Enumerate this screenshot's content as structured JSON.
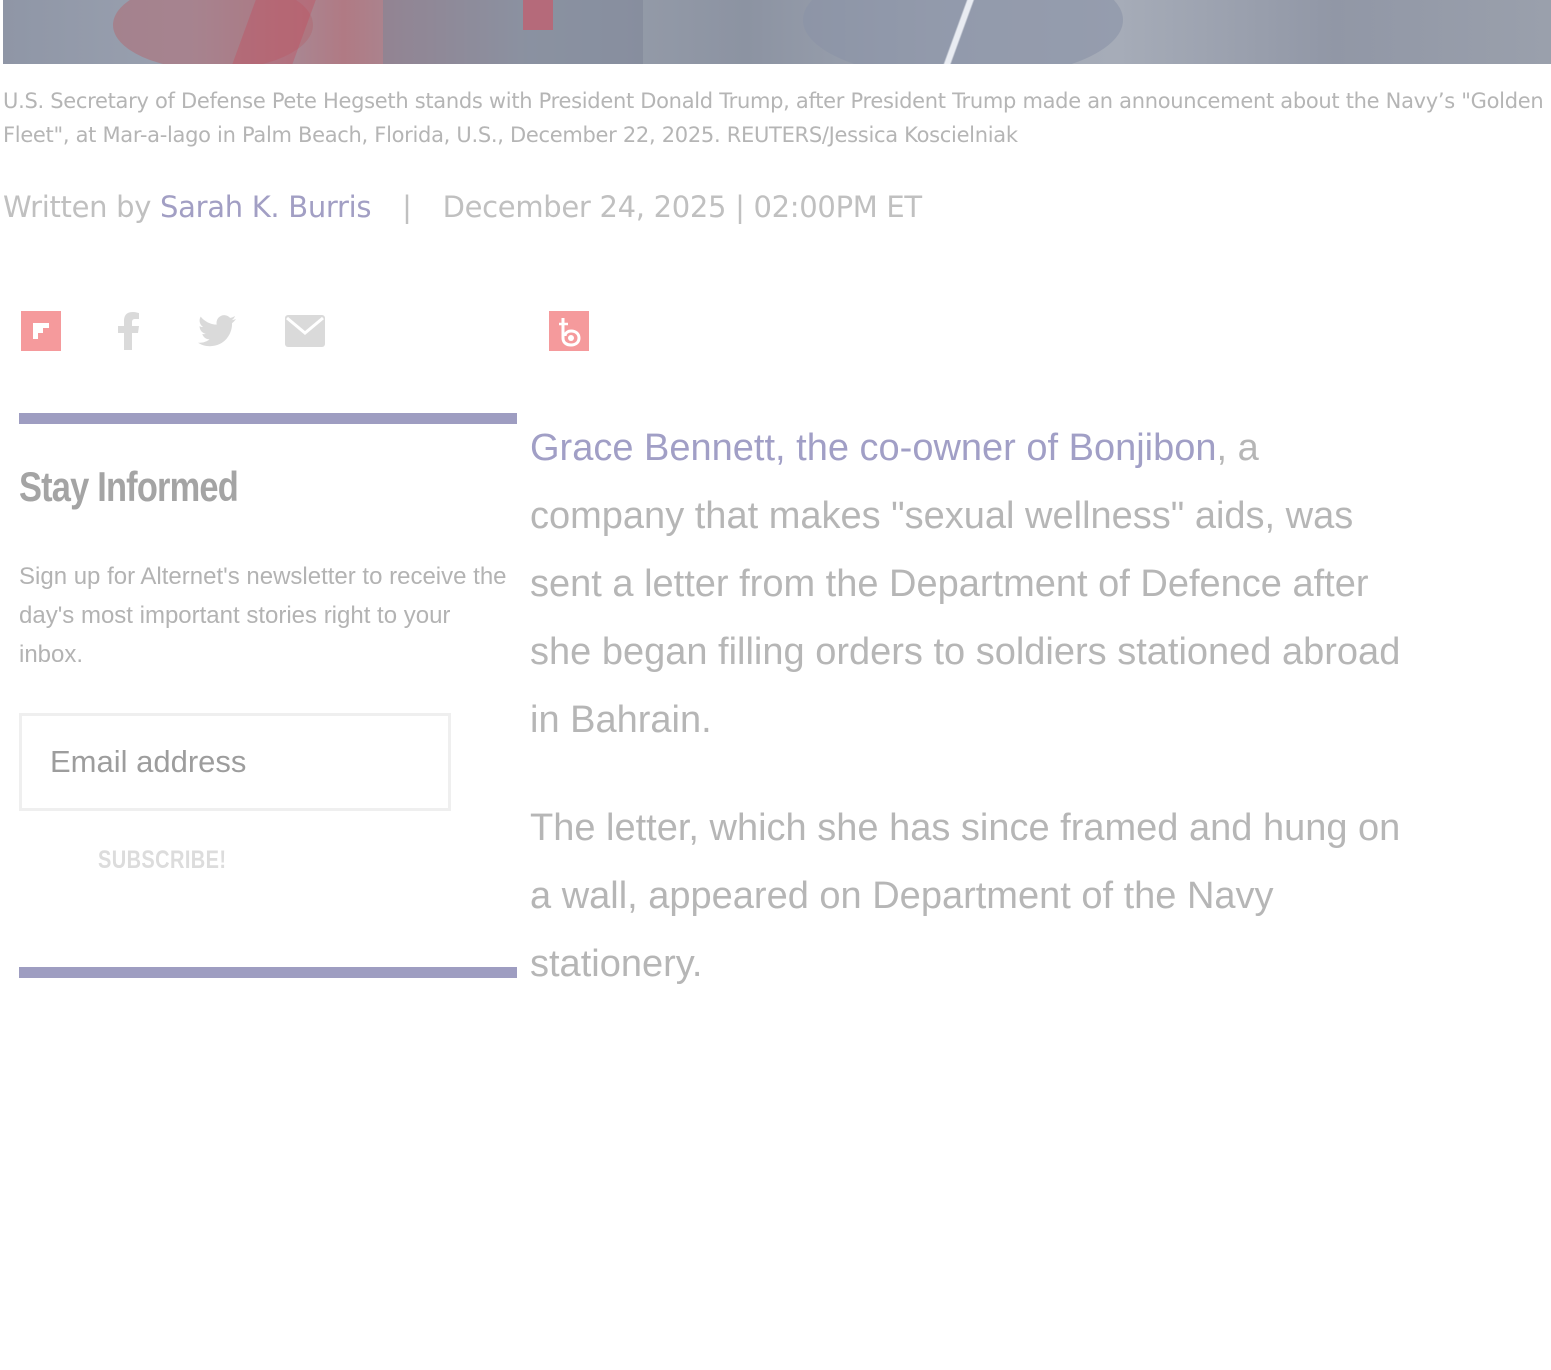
{
  "hero": {
    "image_alt": "photo"
  },
  "caption": "U.S. Secretary of Defense Pete Hegseth stands with President Donald Trump, after President Trump made an announcement about the Navy’s \"Golden Fleet\", at Mar-a-lago in Palm Beach, Florida, U.S., December 22, 2025. REUTERS/Jessica Koscielniak",
  "byline": {
    "prefix": "Written by",
    "author": "Sarah K. Burris",
    "separator": "|",
    "datetime": "December 24, 2025 | 02:00PM ET"
  },
  "share": {
    "icons": [
      "flipboard-icon",
      "facebook-icon",
      "twitter-icon",
      "email-icon",
      "bonjour-icon"
    ],
    "accent_color": "#f59a9c"
  },
  "newsletter": {
    "title": "Stay Informed",
    "description": "Sign up for Alternet's newsletter to receive the day's most important stories right to your inbox.",
    "email_placeholder": "Email address",
    "subscribe_label": "SUBSCRIBE!",
    "rule_color": "#9e9dc1"
  },
  "article": {
    "p1_link": "Grace Bennett, the co-owner of Bonjibon",
    "p1_rest": ", a company that makes \"sexual wellness\" aids, was sent a letter from the Department of Defence after she began filling orders to soldiers stationed abroad in Bahrain.",
    "p2": "The letter, which she has since framed and hung on a wall, appeared on Department of the Navy stationery.",
    "link_color": "#a19fc6"
  }
}
